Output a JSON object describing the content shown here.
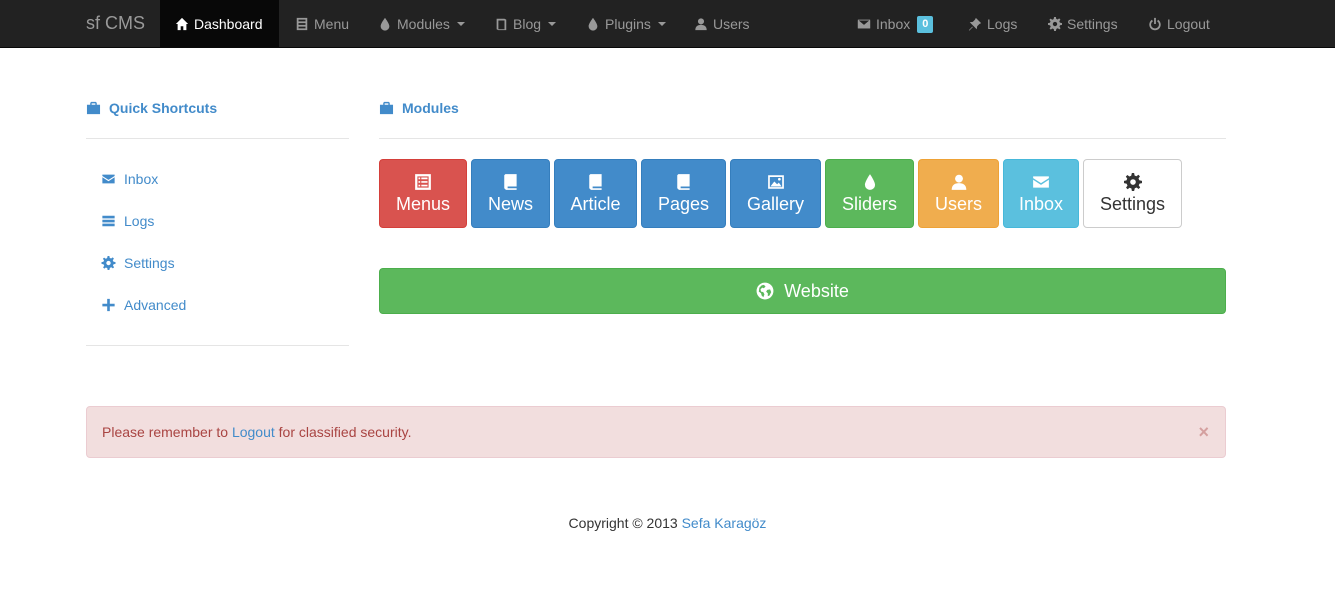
{
  "navbar": {
    "brand": "sf CMS",
    "items": [
      {
        "label": "Dashboard",
        "icon": "home-icon",
        "active": true
      },
      {
        "label": "Menu",
        "icon": "list-icon"
      },
      {
        "label": "Modules",
        "icon": "tint-icon",
        "dropdown": true
      },
      {
        "label": "Blog",
        "icon": "book-icon",
        "dropdown": true
      },
      {
        "label": "Plugins",
        "icon": "tint-icon",
        "dropdown": true
      },
      {
        "label": "Users",
        "icon": "user-icon"
      }
    ],
    "right": [
      {
        "label": "Inbox",
        "icon": "envelope-icon",
        "badge": "0"
      },
      {
        "label": "Logs",
        "icon": "pushpin-icon"
      },
      {
        "label": "Settings",
        "icon": "cog-icon"
      },
      {
        "label": "Logout",
        "icon": "off-icon"
      }
    ]
  },
  "shortcuts": {
    "title": "Quick Shortcuts",
    "items": [
      {
        "label": "Inbox",
        "icon": "envelope-icon"
      },
      {
        "label": "Logs",
        "icon": "tasks-icon"
      },
      {
        "label": "Settings",
        "icon": "cog-icon"
      },
      {
        "label": "Advanced",
        "icon": "plus-icon"
      }
    ]
  },
  "modules": {
    "title": "Modules",
    "tiles": [
      {
        "label": "Menus",
        "icon": "list-alt-icon",
        "color": "#d9534f"
      },
      {
        "label": "News",
        "icon": "book-icon",
        "color": "#428bca"
      },
      {
        "label": "Article",
        "icon": "book-icon",
        "color": "#428bca"
      },
      {
        "label": "Pages",
        "icon": "book-icon",
        "color": "#428bca"
      },
      {
        "label": "Gallery",
        "icon": "picture-icon",
        "color": "#428bca"
      },
      {
        "label": "Sliders",
        "icon": "tint-icon",
        "color": "#5cb85c"
      },
      {
        "label": "Users",
        "icon": "user-icon",
        "color": "#f0ad4e"
      },
      {
        "label": "Inbox",
        "icon": "envelope-icon",
        "color": "#5bc0de"
      },
      {
        "label": "Settings",
        "icon": "cog-icon",
        "color": "#ffffff"
      }
    ],
    "website_label": "Website",
    "website_icon": "globe-icon"
  },
  "alert": {
    "text_before": "Please remember to ",
    "link": "Logout",
    "text_after": " for classified security.",
    "close": "×"
  },
  "footer": {
    "text": "Copyright © 2013 ",
    "author": "Sefa Karagöz"
  }
}
